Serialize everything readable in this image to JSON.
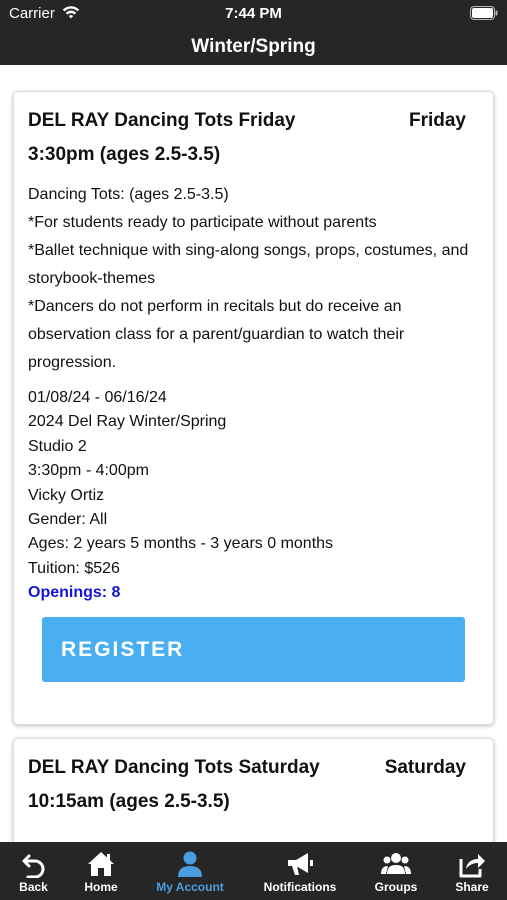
{
  "status_bar": {
    "carrier": "Carrier",
    "time": "7:44 PM"
  },
  "nav": {
    "title": "Winter/Spring"
  },
  "classes": [
    {
      "title": "DEL RAY Dancing Tots Friday 3:30pm (ages 2.5-3.5)",
      "day": "Friday",
      "description": [
        "Dancing Tots: (ages 2.5-3.5)",
        "*For students ready to participate without parents",
        "*Ballet technique with sing-along songs, props, costumes, and storybook-themes",
        "*Dancers do not perform in recitals but do receive an observation class for a parent/guardian to watch their progression."
      ],
      "dates": "01/08/24 - 06/16/24",
      "session": "2024 Del Ray Winter/Spring",
      "location": "Studio 2",
      "time": "3:30pm - 4:00pm",
      "instructor": "Vicky Ortiz",
      "gender": "Gender: All",
      "ages": "Ages: 2 years 5 months - 3 years 0 months",
      "tuition": "Tuition: $526",
      "openings": "Openings: 8",
      "register_label": "REGISTER"
    },
    {
      "title": "DEL RAY Dancing Tots Saturday 10:15am (ages 2.5-3.5)",
      "day": "Saturday"
    }
  ],
  "tab_bar": {
    "items": [
      {
        "label": "Back",
        "icon": "back-arrow-icon"
      },
      {
        "label": "Home",
        "icon": "home-icon"
      },
      {
        "label": "My Account",
        "icon": "user-icon"
      },
      {
        "label": "Notifications",
        "icon": "megaphone-icon"
      },
      {
        "label": "Groups",
        "icon": "groups-icon"
      },
      {
        "label": "Share",
        "icon": "share-icon"
      }
    ],
    "active_index": 2
  },
  "colors": {
    "bar_background": "#262626",
    "register_button": "#4aaef3",
    "openings_text": "#1515d0",
    "active_tab": "#4a9ee0"
  }
}
